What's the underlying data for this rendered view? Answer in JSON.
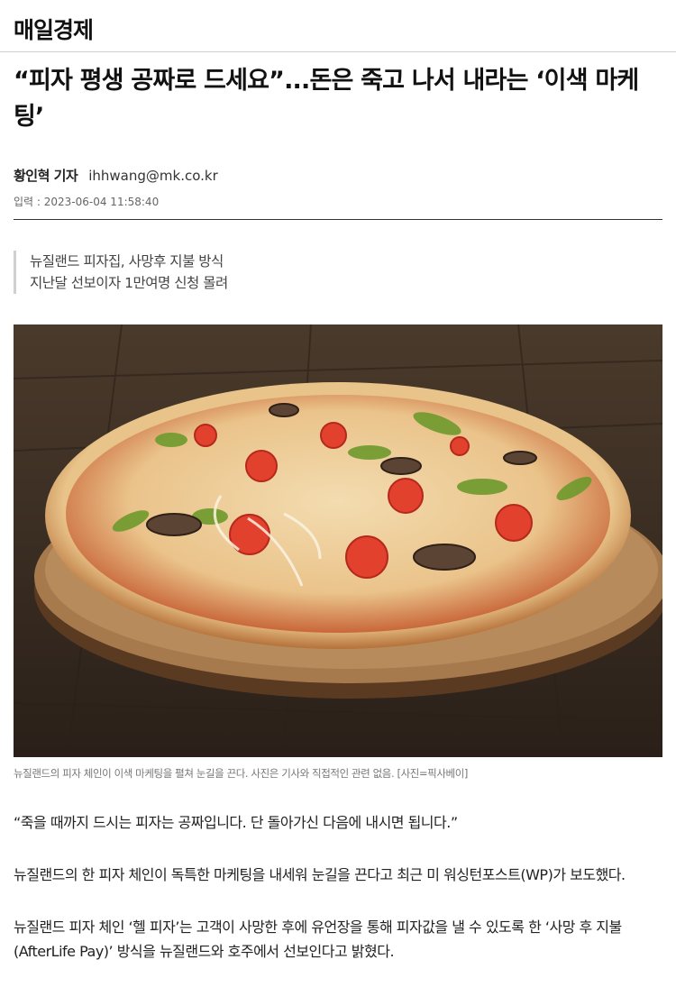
{
  "masthead": {
    "logo_text": "매일경제"
  },
  "article": {
    "headline": "“피자 평생 공짜로 드세요”...돈은 죽고 나서 내라는 ‘이색 마케팅’",
    "reporter": "황인혁 기자",
    "email": "ihhwang@mk.co.kr",
    "published": "입력 : 2023-06-04 11:58:40",
    "subheads": [
      "뉴질랜드 피자집, 사망후 지불 방식",
      "지난달 선보이자 1만여명 신청 몰려"
    ],
    "photo_caption": "뉴질랜드의 피자 체인이 이색 마케팅을 펼쳐 눈길을 끈다. 사진은 기사와 직접적인 관련 없음. [사진=픽사베이]",
    "paragraphs": [
      "“죽을 때까지 드시는 피자는 공짜입니다. 단 돌아가신 다음에 내시면 됩니다.”",
      "뉴질랜드의 한 피자 체인이 독특한 마케팅을 내세워 눈길을 끈다고 최근 미 워싱턴포스트(WP)가 보도했다.",
      "뉴질랜드 피자 체인 ‘헬 피자’는 고객이 사망한 후에 유언장을 통해 피자값을 낼 수 있도록 한 ‘사망 후 지불(AfterLife Pay)’ 방식을 뉴질랜드와 호주에서 선보인다고 밝혔다."
    ]
  }
}
